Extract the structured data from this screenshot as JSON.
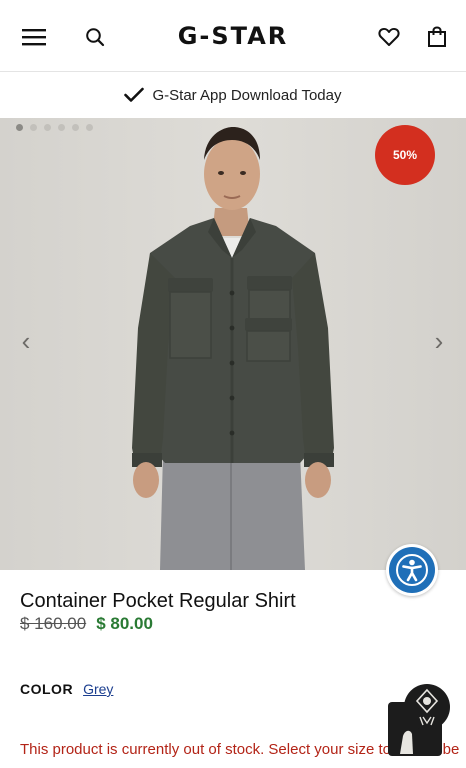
{
  "header": {
    "logo": "G-STAR"
  },
  "banner": {
    "text": "G-Star App Download Today"
  },
  "gallery": {
    "dot_count": 6,
    "active_dot": 0,
    "discount_badge": "50%",
    "prev_arrow": "‹",
    "next_arrow": "›"
  },
  "product": {
    "title": "Container Pocket Regular Shirt",
    "original_price": "$ 160.00",
    "sale_price": "$ 80.00",
    "color_label": "COLOR",
    "color_value": "Grey",
    "stock_message": "This product is currently out of stock. Select your size to subscribe to get notified when your size is back in stock."
  },
  "icons": {
    "menu": "hamburger-menu-icon",
    "search": "search-icon",
    "wishlist": "heart-icon",
    "bag": "shopping-bag-icon",
    "check": "check-icon",
    "accessibility": "accessibility-icon",
    "chat": "chat-assistant-icon"
  },
  "colors": {
    "badge": "#d32f1f",
    "sale_price": "#2a7a34",
    "stock_message": "#b32417",
    "accessibility": "#1f6fb8"
  }
}
